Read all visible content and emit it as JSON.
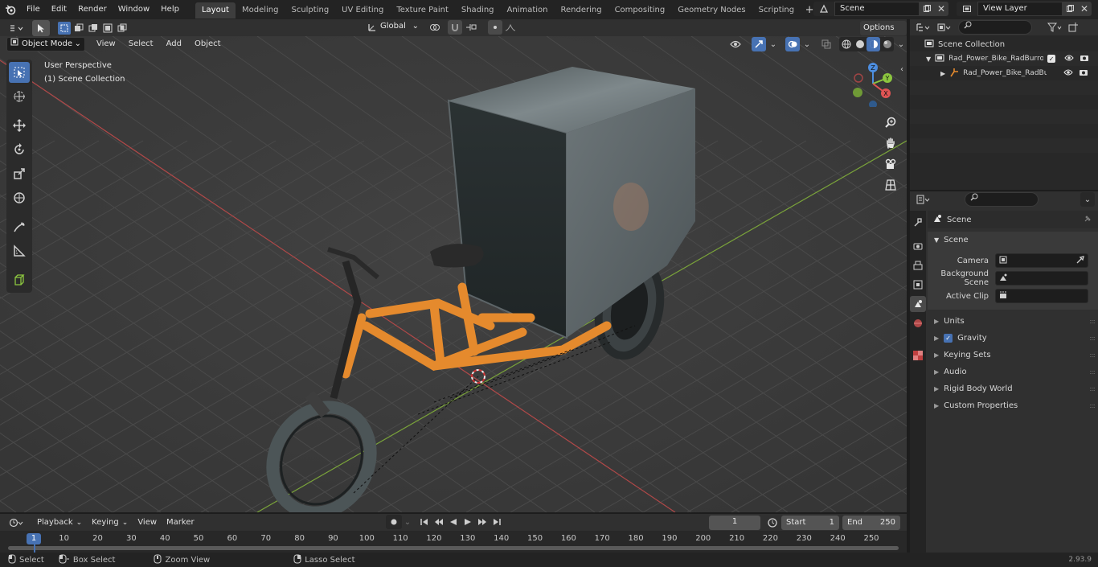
{
  "menu": [
    "File",
    "Edit",
    "Render",
    "Window",
    "Help"
  ],
  "workspaces": [
    "Layout",
    "Modeling",
    "Sculpting",
    "UV Editing",
    "Texture Paint",
    "Shading",
    "Animation",
    "Rendering",
    "Compositing",
    "Geometry Nodes",
    "Scripting"
  ],
  "active_workspace": "Layout",
  "scene_name": "Scene",
  "view_layer": "View Layer",
  "viewport": {
    "mode": "Object Mode",
    "menus": [
      "View",
      "Select",
      "Add",
      "Object"
    ],
    "transform_orientation": "Global",
    "options_label": "Options",
    "overlay_title": "User Perspective",
    "overlay_sub": "(1) Scene Collection",
    "gizmo": {
      "x": "X",
      "y": "Y",
      "z": "Z"
    }
  },
  "outliner": {
    "root": "Scene Collection",
    "items": [
      {
        "label": "Rad_Power_Bike_RadBurro_v"
      },
      {
        "label": "Rad_Power_Bike_RadBu"
      }
    ]
  },
  "properties": {
    "context": "Scene",
    "panel": "Scene",
    "fields": [
      {
        "label": "Camera"
      },
      {
        "label": "Background Scene"
      },
      {
        "label": "Active Clip"
      }
    ],
    "sections": [
      "Units",
      "Gravity",
      "Keying Sets",
      "Audio",
      "Rigid Body World",
      "Custom Properties"
    ]
  },
  "timeline": {
    "menus": [
      "Playback",
      "Keying",
      "View",
      "Marker"
    ],
    "current_frame": "1",
    "start_label": "Start",
    "start": "1",
    "end_label": "End",
    "end": "250",
    "ticks": [
      "1",
      "10",
      "20",
      "30",
      "40",
      "50",
      "60",
      "70",
      "80",
      "90",
      "100",
      "110",
      "120",
      "130",
      "140",
      "150",
      "160",
      "170",
      "180",
      "190",
      "200",
      "210",
      "220",
      "230",
      "240",
      "250"
    ]
  },
  "statusbar": {
    "items": [
      "Select",
      "Box Select",
      "Zoom View",
      "Lasso Select"
    ],
    "version": "2.93.9"
  },
  "colors": {
    "accent": "#4772b3",
    "frame": "#e58a2d",
    "x_axis": "#e05454",
    "y_axis": "#8cc63f",
    "z_axis": "#4d8ee0"
  }
}
